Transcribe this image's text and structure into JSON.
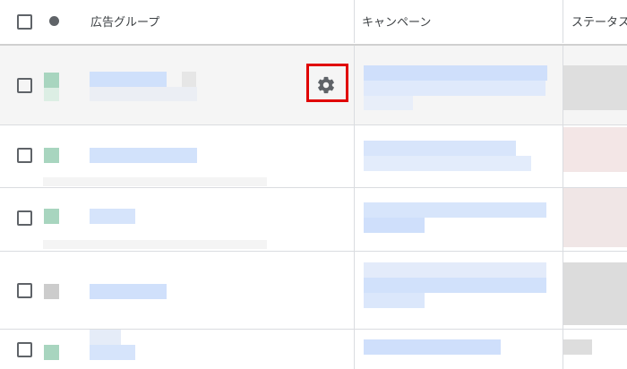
{
  "header": {
    "ad_group_label": "広告グループ",
    "campaign_label": "キャンペーン",
    "status_label": "ステータス"
  },
  "rows": [
    {
      "status_color": "#a8d5bf",
      "has_settings_icon": true
    },
    {
      "status_color": "#a8d5bf",
      "has_settings_icon": false
    },
    {
      "status_color": "#a8d5bf",
      "has_settings_icon": false
    },
    {
      "status_color": "#cccccc",
      "has_settings_icon": false
    },
    {
      "status_color": "#a8d5bf",
      "has_settings_icon": false
    }
  ],
  "icons": {
    "row_settings": "gear-icon",
    "status_header": "status-dot-icon"
  },
  "colors": {
    "highlight": "#e00000",
    "selected_row_bg": "#f5f5f5",
    "redacted_link": "#c6dafc"
  }
}
